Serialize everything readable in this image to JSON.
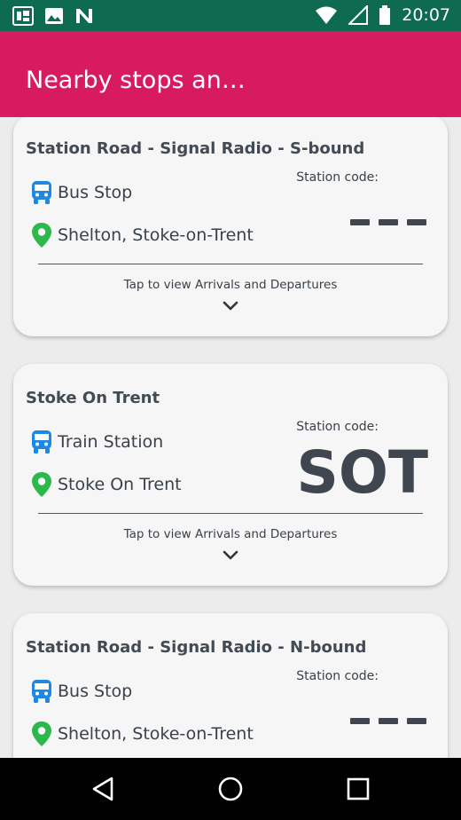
{
  "status_bar": {
    "time": "20:07",
    "left_icons": [
      "sim-card-icon",
      "image-icon",
      "n-app-icon"
    ],
    "right_icons": [
      "wifi-icon",
      "signal-icon",
      "battery-icon"
    ],
    "bg_color": "#0e6b52"
  },
  "app_bar": {
    "title": "Nearby stops an…",
    "bg_color": "#d81b60"
  },
  "cards": [
    {
      "title": "Station Road - Signal Radio - S-bound",
      "type_label": "Bus Stop",
      "location": "Shelton, Stoke-on-Trent",
      "code_label": "Station code:",
      "code": "",
      "tap_text": "Tap to view Arrivals and Departures"
    },
    {
      "title": "Stoke On Trent",
      "type_label": "Train Station",
      "location": "Stoke On Trent",
      "code_label": "Station code:",
      "code": "SOT",
      "tap_text": "Tap to view Arrivals and Departures"
    },
    {
      "title": "Station Road - Signal Radio - N-bound",
      "type_label": "Bus Stop",
      "location": "Shelton, Stoke-on-Trent",
      "code_label": "Station code:",
      "code": "",
      "tap_text": ""
    }
  ],
  "colors": {
    "transit_icon": "#1e88e5",
    "pin_icon": "#2db84c"
  },
  "nav_bar": {
    "buttons": [
      "back-icon",
      "home-icon",
      "recents-icon"
    ]
  }
}
